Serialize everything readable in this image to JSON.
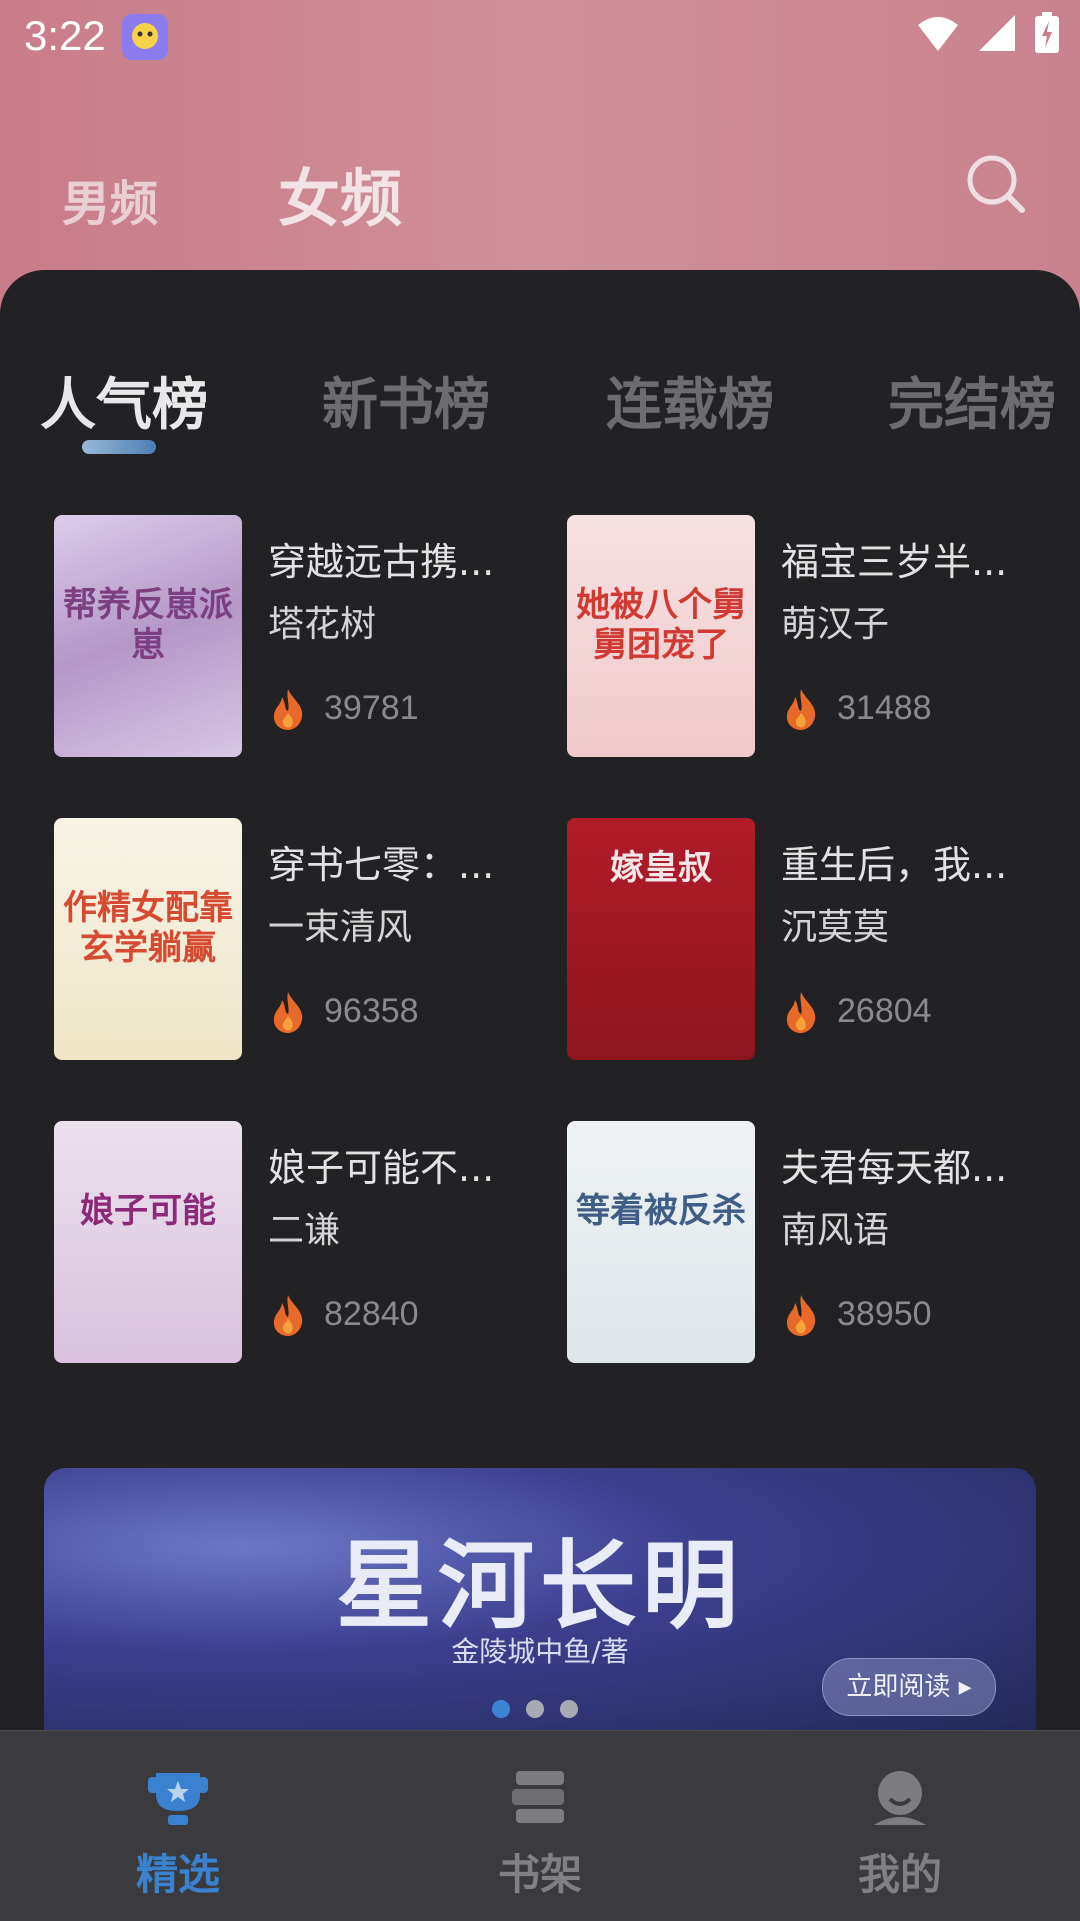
{
  "status_bar": {
    "time": "3:22"
  },
  "gender_tabs": {
    "male": "男频",
    "female": "女频",
    "active": "女频"
  },
  "rank_tabs": [
    {
      "label": "人气榜",
      "active": true
    },
    {
      "label": "新书榜",
      "active": false
    },
    {
      "label": "连载榜",
      "active": false
    },
    {
      "label": "完结榜",
      "active": false
    }
  ],
  "books": [
    {
      "title": "穿越远古携...",
      "author": "塔花树",
      "heat": "39781",
      "cover_text": "帮养反崽派崽",
      "cover_colors": [
        "#c9b4d8",
        "#7c5a8e"
      ]
    },
    {
      "title": "福宝三岁半...",
      "author": "萌汉子",
      "heat": "31488",
      "cover_text": "她被八个舅舅团宠了",
      "cover_colors": [
        "#f3d5d6",
        "#d33b33"
      ]
    },
    {
      "title": "穿书七零：...",
      "author": "一束清风",
      "heat": "96358",
      "cover_text": "作精女配靠玄学躺赢",
      "cover_colors": [
        "#f6f1e0",
        "#d64a32"
      ]
    },
    {
      "title": "重生后，我...",
      "author": "沉莫莫",
      "heat": "26804",
      "cover_text": "嫁皇叔",
      "cover_colors": [
        "#b81f2a",
        "#f4e5e5"
      ]
    },
    {
      "title": "娘子可能不...",
      "author": "二谦",
      "heat": "82840",
      "cover_text": "娘子可能",
      "cover_colors": [
        "#eadcec",
        "#8c2a78"
      ]
    },
    {
      "title": "夫君每天都...",
      "author": "南风语",
      "heat": "38950",
      "cover_text": "等着被反杀",
      "cover_colors": [
        "#e8eef2",
        "#3f5d86"
      ]
    }
  ],
  "banner": {
    "title": "星河长明",
    "subtitle": "金陵城中鱼/著",
    "button": "立即阅读 ▸",
    "dots": 3,
    "active_dot": 0
  },
  "bottom_nav": [
    {
      "label": "精选",
      "icon": "trophy-icon",
      "active": true
    },
    {
      "label": "书架",
      "icon": "bookshelf-icon",
      "active": false
    },
    {
      "label": "我的",
      "icon": "profile-icon",
      "active": false
    }
  ],
  "colors": {
    "accent": "#3a82cf",
    "header": "#cf8f99",
    "panel": "#222224",
    "nav": "#3b3b3e"
  }
}
